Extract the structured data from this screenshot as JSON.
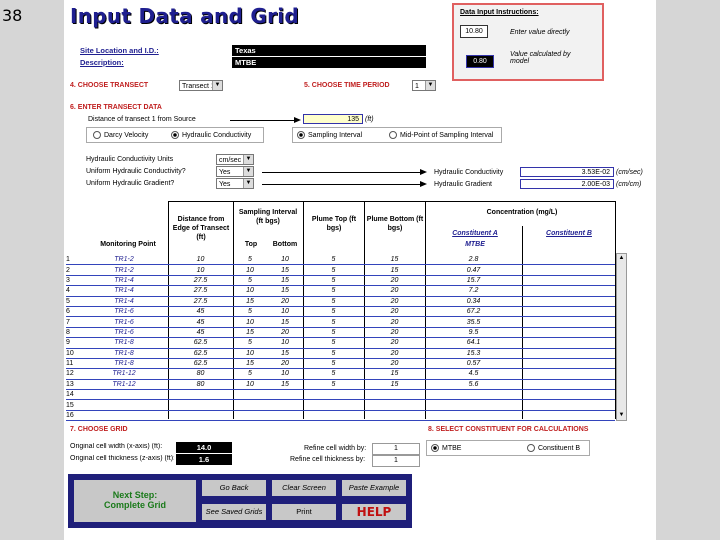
{
  "slide_number": "38",
  "title": "Input Data and Grid",
  "instructions": {
    "heading": "Data Input Instructions:",
    "example1_value": "10.80",
    "example1_label": "Enter value directly",
    "example2_value": "0.80",
    "example2_label": "Value calculated by model"
  },
  "site": {
    "location_label": "Site Location and I.D.:",
    "location_value": "Texas",
    "description_label": "Description:",
    "description_value": "MTBE"
  },
  "sections": {
    "s4": "4. CHOOSE TRANSECT",
    "s4_value": "Transect 1",
    "s5": "5. CHOOSE TIME PERIOD",
    "s5_value": "1",
    "s6": "6. ENTER TRANSECT DATA",
    "distance_label": "Distance of transect 1 from Source",
    "distance_value": "135",
    "distance_unit": "(ft)",
    "radio_darcy": "Darcy Velocity",
    "radio_hydraulic": "Hydraulic Conductivity",
    "radio_sampling": "Sampling Interval",
    "radio_midpoint": "Mid-Point of Sampling Interval",
    "hc_units_label": "Hydraulic Conductivity Units",
    "hc_units_value": "cm/sec",
    "uniform_hc_label": "Uniform Hydraulic Conductivity?",
    "uniform_hc_value": "Yes",
    "uniform_hg_label": "Uniform Hydraulic Gradient?",
    "uniform_hg_value": "Yes",
    "hc_out_label": "Hydraulic Conductivity",
    "hc_out_value": "3.53E-02",
    "hc_out_unit": "(cm/sec)",
    "hg_out_label": "Hydraulic Gradient",
    "hg_out_value": "2.00E-03",
    "hg_out_unit": "(cm/cm)"
  },
  "table": {
    "col_mp": "Monitoring Point",
    "col_dist": "Distance from Edge of Transect (ft)",
    "col_si": "Sampling Interval (ft bgs)",
    "col_top": "Top",
    "col_bottom": "Bottom",
    "col_pt": "Plume Top (ft bgs)",
    "col_pb": "Plume Bottom (ft bgs)",
    "col_conc": "Concentration (mg/L)",
    "col_ca": "Constituent A",
    "col_cb": "Constituent B",
    "ca_name": "MTBE",
    "rows": [
      [
        "1",
        "TR1-2",
        "10",
        "5",
        "10",
        "5",
        "15",
        "2.8",
        ""
      ],
      [
        "2",
        "TR1-2",
        "10",
        "10",
        "15",
        "5",
        "15",
        "0.47",
        ""
      ],
      [
        "3",
        "TR1-4",
        "27.5",
        "5",
        "15",
        "5",
        "20",
        "15.7",
        ""
      ],
      [
        "4",
        "TR1-4",
        "27.5",
        "10",
        "15",
        "5",
        "20",
        "7.2",
        ""
      ],
      [
        "5",
        "TR1-4",
        "27.5",
        "15",
        "20",
        "5",
        "20",
        "0.34",
        ""
      ],
      [
        "6",
        "TR1-6",
        "45",
        "5",
        "10",
        "5",
        "20",
        "67.2",
        ""
      ],
      [
        "7",
        "TR1-6",
        "45",
        "10",
        "15",
        "5",
        "20",
        "35.5",
        ""
      ],
      [
        "8",
        "TR1-6",
        "45",
        "15",
        "20",
        "5",
        "20",
        "9.5",
        ""
      ],
      [
        "9",
        "TR1-8",
        "62.5",
        "5",
        "10",
        "5",
        "20",
        "64.1",
        ""
      ],
      [
        "10",
        "TR1-8",
        "62.5",
        "10",
        "15",
        "5",
        "20",
        "15.3",
        ""
      ],
      [
        "11",
        "TR1-8",
        "62.5",
        "15",
        "20",
        "5",
        "20",
        "0.57",
        ""
      ],
      [
        "12",
        "TR1-12",
        "80",
        "5",
        "10",
        "5",
        "15",
        "4.5",
        ""
      ],
      [
        "13",
        "TR1-12",
        "80",
        "10",
        "15",
        "5",
        "15",
        "5.6",
        ""
      ],
      [
        "14",
        "",
        "",
        "",
        "",
        "",
        "",
        "",
        ""
      ],
      [
        "15",
        "",
        "",
        "",
        "",
        "",
        "",
        "",
        ""
      ],
      [
        "16",
        "",
        "",
        "",
        "",
        "",
        "",
        "",
        ""
      ]
    ]
  },
  "grid": {
    "s7": "7. CHOOSE GRID",
    "orig_width_label": "Original cell width (x-axis) (ft):",
    "orig_width_value": "14.0",
    "orig_thick_label": "Original cell thickness (z-axis) (ft):",
    "orig_thick_value": "1.6",
    "refine_width_label": "Refine cell width by:",
    "refine_width_value": "1",
    "refine_thick_label": "Refine cell thickness by:",
    "refine_thick_value": "1",
    "s8": "8. SELECT CONSTITUENT FOR CALCULATIONS",
    "const_a": "MTBE",
    "const_b": "Constituent B"
  },
  "buttons": {
    "next_step_line1": "Next Step:",
    "next_step_line2": "Complete Grid",
    "go_back": "Go Back",
    "clear_screen": "Clear Screen",
    "paste_example": "Paste Example",
    "see_saved": "See Saved Grids",
    "print": "Print",
    "help": "HELP"
  }
}
